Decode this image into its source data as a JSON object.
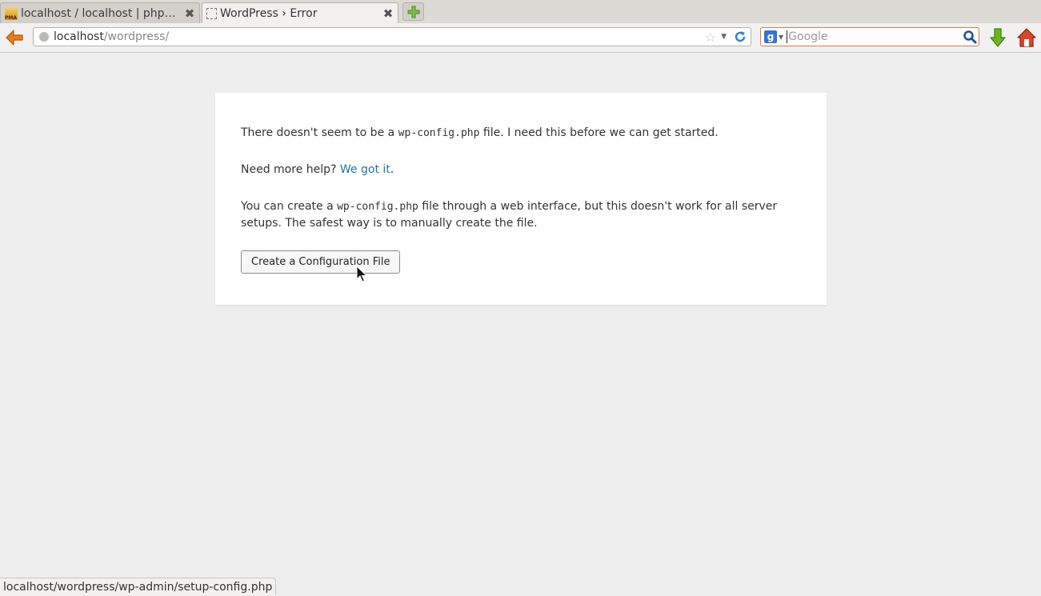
{
  "browser": {
    "tabs": [
      {
        "title": "localhost / localhost | phpM…",
        "favicon": "pma-icon",
        "active": false
      },
      {
        "title": "WordPress › Error",
        "favicon": "blank-page-icon",
        "active": true
      }
    ],
    "url": {
      "host": "localhost",
      "path": "/wordpress/"
    },
    "search": {
      "engine": "google-icon",
      "placeholder": "Google",
      "value": ""
    },
    "status_text": "localhost/wordpress/wp-admin/setup-config.php"
  },
  "page": {
    "message1": {
      "before": "There doesn't seem to be a ",
      "code": "wp-config.php",
      "after": " file. I need this before we can get started."
    },
    "help": {
      "before": "Need more help? ",
      "link": "We got it",
      "after": "."
    },
    "message2": {
      "before": "You can create a ",
      "code": "wp-config.php",
      "after": " file through a web interface, but this doesn't work for all server setups. The safest way is to manually create the file."
    },
    "button_label": "Create a Configuration File"
  },
  "colors": {
    "link": "#21759b",
    "search_focus": "#e37b3a",
    "back_arrow": "#e87d1f",
    "download_arrow": "#6cb51c",
    "home": "#d8452b"
  }
}
